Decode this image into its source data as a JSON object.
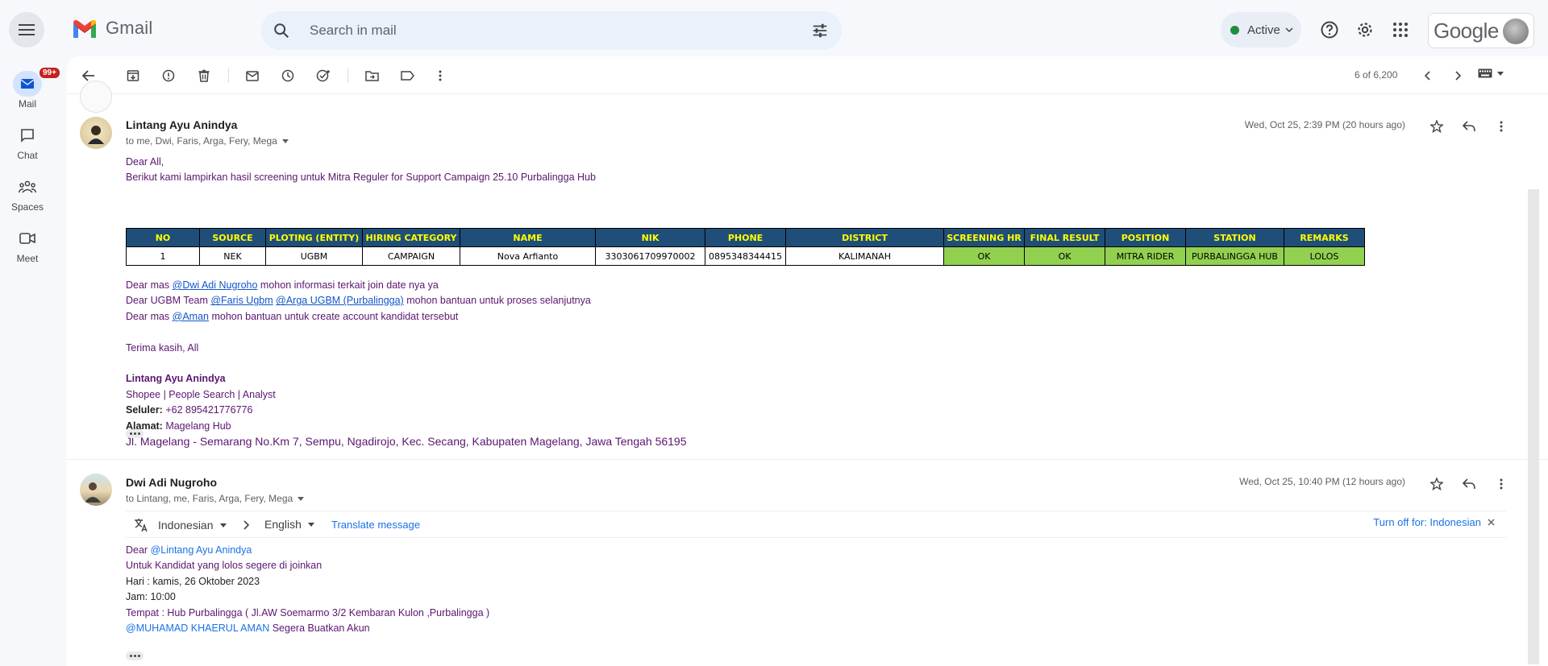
{
  "app": {
    "name": "Gmail"
  },
  "search": {
    "placeholder": "Search in mail"
  },
  "status": {
    "label": "Active"
  },
  "account": {
    "label": "Google"
  },
  "rail": {
    "items": [
      {
        "label": "Mail",
        "badge": "99+"
      },
      {
        "label": "Chat"
      },
      {
        "label": "Spaces"
      },
      {
        "label": "Meet"
      }
    ]
  },
  "toolbar": {
    "pager": "6 of 6,200"
  },
  "message1": {
    "sender": "Lintang Ayu Anindya",
    "recipients": "to me, Dwi, Faris, Arga, Fery, Mega",
    "date": "Wed, Oct 25, 2:39 PM (20 hours ago)",
    "greeting": "Dear All,",
    "intro": "Berikut kami lampirkan hasil screening untuk Mitra Reguler for Support Campaign 25.10 Purbalingga Hub",
    "table": {
      "headers": [
        "NO",
        "SOURCE",
        "PLOTING (ENTITY)",
        "HIRING CATEGORY",
        "NAME",
        "NIK",
        "PHONE",
        "DISTRICT",
        "SCREENING HR",
        "FINAL RESULT",
        "POSITION",
        "STATION",
        "REMARKS"
      ],
      "rows": [
        [
          "1",
          "NEK",
          "UGBM",
          "CAMPAIGN",
          "Nova Arfianto",
          "3303061709970002",
          "0895348344415",
          "KALIMANAH",
          "OK",
          "OK",
          "MITRA RIDER",
          "PURBALINGGA HUB",
          "LOLOS"
        ]
      ]
    },
    "line1": {
      "pre": "Dear mas ",
      "m1": "@Dwi Adi Nugroho",
      "post": " mohon informasi terkait join date nya ya"
    },
    "line2": {
      "pre": "Dear UGBM Team ",
      "m1": "@Faris Ugbm",
      "mid": " ",
      "m2": "@Arga UGBM (Purbalingga)",
      "post": " mohon bantuan untuk proses selanjutnya"
    },
    "line3": {
      "pre": "Dear mas ",
      "m1": "@Aman",
      "post": " mohon bantuan untuk create account kandidat tersebut"
    },
    "thanks": "Terima kasih, All",
    "signature": {
      "name": "Lintang Ayu Anindya",
      "title": "Shopee | People Search | Analyst",
      "phone_label": "Seluler:",
      "phone": " +62 895421776776",
      "addr_label": "Alamat:",
      "addr": " Magelang Hub",
      "street": "Jl. Magelang - Semarang No.Km 7, Sempu, Ngadirojo, Kec. Secang, Kabupaten Magelang, Jawa Tengah 56195"
    }
  },
  "message2": {
    "sender": "Dwi Adi Nugroho",
    "recipients": "to Lintang, me, Faris, Arga, Fery, Mega",
    "date": "Wed, Oct 25, 10:40 PM (12 hours ago)",
    "translate": {
      "from": "Indonesian",
      "to": "English",
      "action": "Translate message",
      "turn_off": "Turn off for: Indonesian"
    },
    "l1": {
      "pre": "Dear ",
      "m1": "@Lintang Ayu Anindya"
    },
    "l2": "Untuk Kandidat yang lolos segere di joinkan",
    "l3": "Hari : kamis, 26 Oktober 2023",
    "l4": "Jam: 10:00",
    "l5": "Tempat : Hub Purbalingga ( Jl.AW Soemarmo 3/2 Kembaran Kulon ,Purbalingga )",
    "l6": {
      "m1": "@MUHAMAD KHAERUL AMAN",
      "post": " Segera Buatkan Akun"
    }
  }
}
